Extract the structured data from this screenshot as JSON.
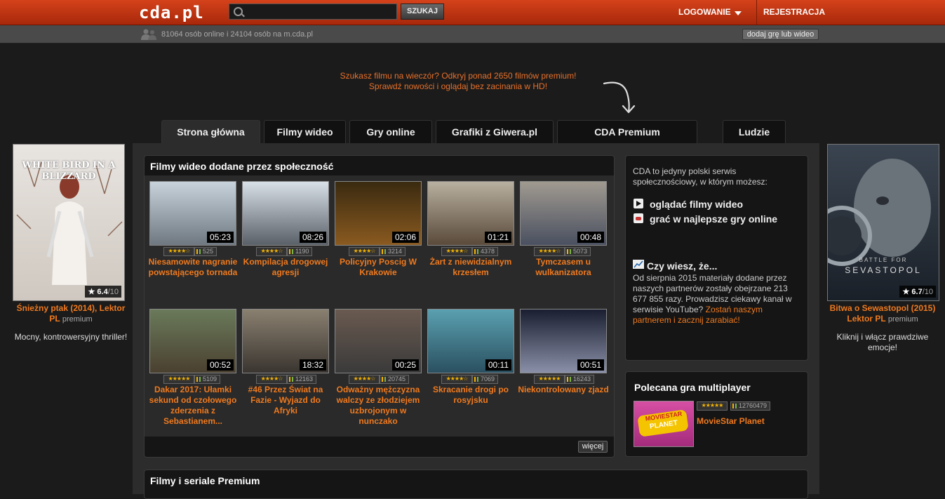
{
  "header": {
    "logo": "cda.pl",
    "search_placeholder": "",
    "search_button": "SZUKAJ",
    "login": "LOGOWANIE",
    "register": "REJESTRACJA"
  },
  "subbar": {
    "online": "81064 osób online i 24104 osób na m.cda.pl",
    "add_button": "dodaj grę lub wideo"
  },
  "promo": {
    "line1": "Szukasz filmu na wieczór? Odkryj ponad 2650 filmów premium!",
    "line2": "Sprawdź nowości i oglądaj bez zacinania w HD!"
  },
  "tabs": [
    {
      "label": "Strona główna"
    },
    {
      "label": "Filmy wideo"
    },
    {
      "label": "Gry online"
    },
    {
      "label": "Grafiki z Giwera.pl"
    },
    {
      "label": "CDA Premium"
    },
    {
      "label": "Ludzie"
    }
  ],
  "left_ad": {
    "poster_line1": "WHITE BIRD IN A",
    "poster_line2": "BLIZZARD",
    "rating": "6.4",
    "rating_den": "/10",
    "title": "Śnieżny ptak (2014), Lektor PL",
    "badge": "premium",
    "desc": "Mocny, kontrowersyjny thriller!"
  },
  "right_ad": {
    "poster_line1": "BATTLE FOR",
    "poster_line2": "SEVASTOPOL",
    "rating": "6.7",
    "rating_den": "/10",
    "title": "Bitwa o Sewastopol (2015) Lektor PL",
    "badge": "premium",
    "desc": "Kliknij i włącz prawdziwe emocje!"
  },
  "videos_panel": {
    "title": "Filmy wideo dodane przez społeczność",
    "more": "więcej",
    "videos": [
      {
        "duration": "05:23",
        "views": "525",
        "stars": "★★★★☆",
        "title": "Niesamowite nagranie powstającego tornada",
        "colors": [
          "#c9d3dc",
          "#6f7880"
        ]
      },
      {
        "duration": "08:26",
        "views": "1190",
        "stars": "★★★★☆",
        "title": "Kompilacja drogowej agresji",
        "colors": [
          "#d8e0e8",
          "#5a6068"
        ]
      },
      {
        "duration": "02:06",
        "views": "3214",
        "stars": "★★★★☆",
        "title": "Policyjny Poscig W Krakowie",
        "colors": [
          "#3a2a10",
          "#8a5a20"
        ]
      },
      {
        "duration": "01:21",
        "views": "4378",
        "stars": "★★★★☆",
        "title": "Żart z niewidzialnym krzesłem",
        "colors": [
          "#b8b0a0",
          "#5a4a3a"
        ]
      },
      {
        "duration": "00:48",
        "views": "5073",
        "stars": "★★★★☆",
        "title": "Tymczasem u wulkanizatora",
        "colors": [
          "#a09a90",
          "#4a5060"
        ]
      },
      {
        "duration": "00:52",
        "views": "5109",
        "stars": "★★★★★",
        "title": "Dakar 2017: Ułamki sekund od czołowego zderzenia z Sebastianem...",
        "colors": [
          "#6a7a5a",
          "#4a4030"
        ]
      },
      {
        "duration": "18:32",
        "views": "12163",
        "stars": "★★★★☆",
        "title": "#46 Przez Świat na Fazie - Wyjazd do Afryki",
        "colors": [
          "#8a8070",
          "#3a3530"
        ]
      },
      {
        "duration": "00:25",
        "views": "20745",
        "stars": "★★★★☆",
        "title": "Odważny mężczyzna walczy ze złodziejem uzbrojonym w nunczako",
        "colors": [
          "#6a5a50",
          "#3a3a3a"
        ]
      },
      {
        "duration": "00:11",
        "views": "7069",
        "stars": "★★★★☆",
        "title": "Skracanie drogi po rosyjsku",
        "colors": [
          "#5aa0b0",
          "#2a5060"
        ]
      },
      {
        "duration": "00:51",
        "views": "16243",
        "stars": "★★★★★",
        "title": "Niekontrolowany zjazd",
        "colors": [
          "#1a1e30",
          "#8a90a8"
        ]
      }
    ]
  },
  "info_panel": {
    "intro": "CDA to jedyny polski serwis społecznościowy, w którym możesz:",
    "feature1": "oglądać filmy wideo",
    "feature2": "grać w najlepsze gry online",
    "did_you_know": "Czy wiesz, że...",
    "fact_text": "Od sierpnia 2015 materiały dodane przez naszych partnerów zostały obejrzane 213 677 855 razy. Prowadzisz ciekawy kanał w serwisie YouTube?",
    "fact_link": "Zostań naszym partnerem i zacznij zarabiać!"
  },
  "game_panel": {
    "title": "Polecana gra multiplayer",
    "thumb_line1": "MOVIESTAR",
    "thumb_line2": "PLANET",
    "stars": "★★★★★",
    "views": "12760479",
    "name": "MovieStar Planet"
  },
  "premium_panel": {
    "title": "Filmy i seriale Premium"
  }
}
